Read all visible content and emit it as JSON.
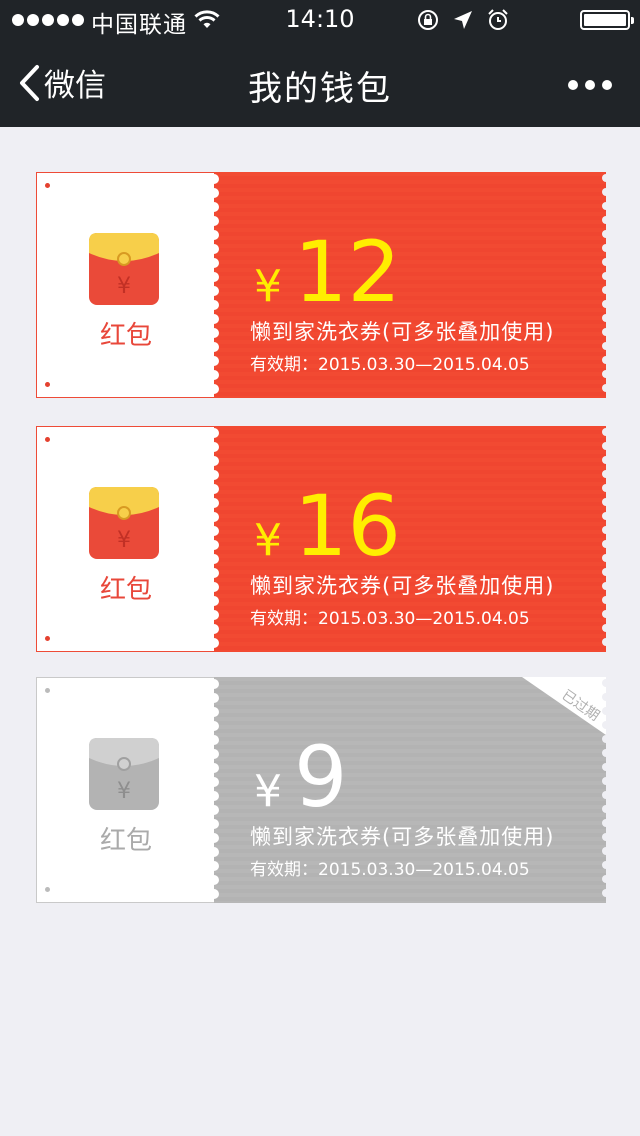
{
  "status_bar": {
    "carrier": "中国联通",
    "time": "14:10",
    "signal_bars": 5
  },
  "nav": {
    "back_label": "微信",
    "title": "我的钱包",
    "more_icon": "more-icon"
  },
  "colors": {
    "active_red": "#f24a32",
    "amount_yellow": "#ffee00",
    "expired_gray": "#b5b5b5",
    "nav_bg": "#202428"
  },
  "coupons": [
    {
      "label": "红包",
      "currency": "¥",
      "amount": "12",
      "description": "懒到家洗衣券(可多张叠加使用)",
      "validity": "有效期：2015.03.30—2015.04.05",
      "expired": false
    },
    {
      "label": "红包",
      "currency": "¥",
      "amount": "16",
      "description": "懒到家洗衣券(可多张叠加使用)",
      "validity": "有效期：2015.03.30—2015.04.05",
      "expired": false
    },
    {
      "label": "红包",
      "currency": "¥",
      "amount": "9",
      "description": "懒到家洗衣券(可多张叠加使用)",
      "validity": "有效期：2015.03.30—2015.04.05",
      "expired": true,
      "badge": "已过期"
    }
  ]
}
